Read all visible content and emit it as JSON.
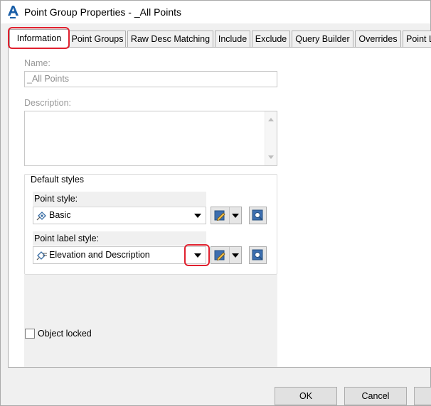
{
  "window": {
    "title": "Point Group Properties - _All Points",
    "app_icon": "autocad-civil3d-icon"
  },
  "tabs": [
    {
      "label": "Information",
      "active": true
    },
    {
      "label": "Point Groups"
    },
    {
      "label": "Raw Desc Matching"
    },
    {
      "label": "Include"
    },
    {
      "label": "Exclude"
    },
    {
      "label": "Query Builder"
    },
    {
      "label": "Overrides"
    },
    {
      "label": "Point L"
    }
  ],
  "info": {
    "name_label": "Name:",
    "name_value": "_All Points",
    "description_label": "Description:",
    "description_value": ""
  },
  "default_styles": {
    "legend": "Default styles",
    "point_style_label": "Point style:",
    "point_style_value": "Basic",
    "point_label_style_label": "Point label style:",
    "point_label_style_value": "Elevation and Description"
  },
  "object_locked": {
    "label": "Object locked",
    "checked": false
  },
  "buttons": {
    "ok": "OK",
    "cancel": "Cancel"
  },
  "annotation_color": "#e0202e"
}
